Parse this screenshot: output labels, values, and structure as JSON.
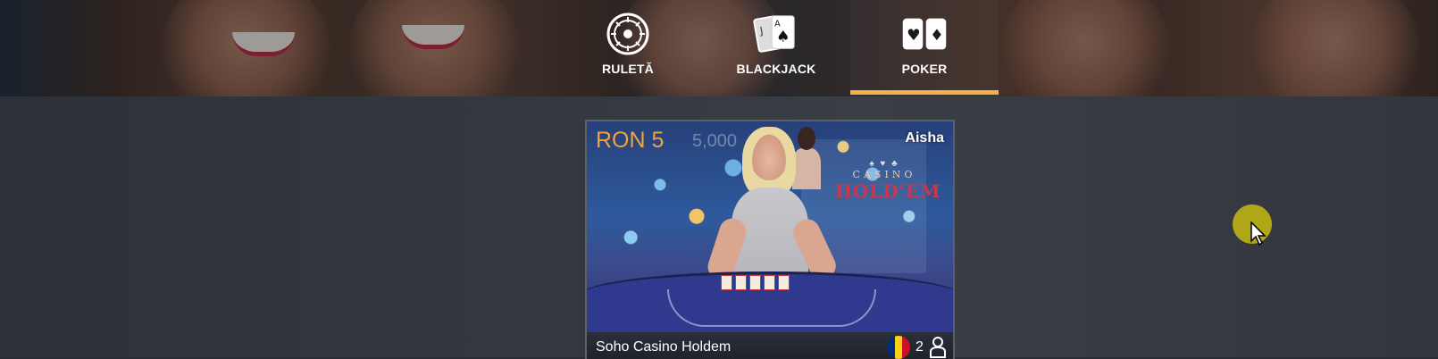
{
  "nav": {
    "tabs": [
      {
        "label": "RULETĂ",
        "icon": "roulette-icon",
        "active": false
      },
      {
        "label": "BLACKJACK",
        "icon": "cards-jack-ace-icon",
        "active": false
      },
      {
        "label": "POKER",
        "icon": "poker-cards-icon",
        "active": true
      }
    ],
    "accent_color": "#f2b14b"
  },
  "game_card": {
    "stake": "RON 5",
    "stake_secondary": "5,000",
    "dealer_name": "Aisha",
    "table_logo_top": "CASINO",
    "table_logo_bottom": "HOLD'EM",
    "title": "Soho Casino Holdem",
    "flag": "romania-flag-icon",
    "player_count": "2",
    "stake_color": "#f2a23c"
  }
}
